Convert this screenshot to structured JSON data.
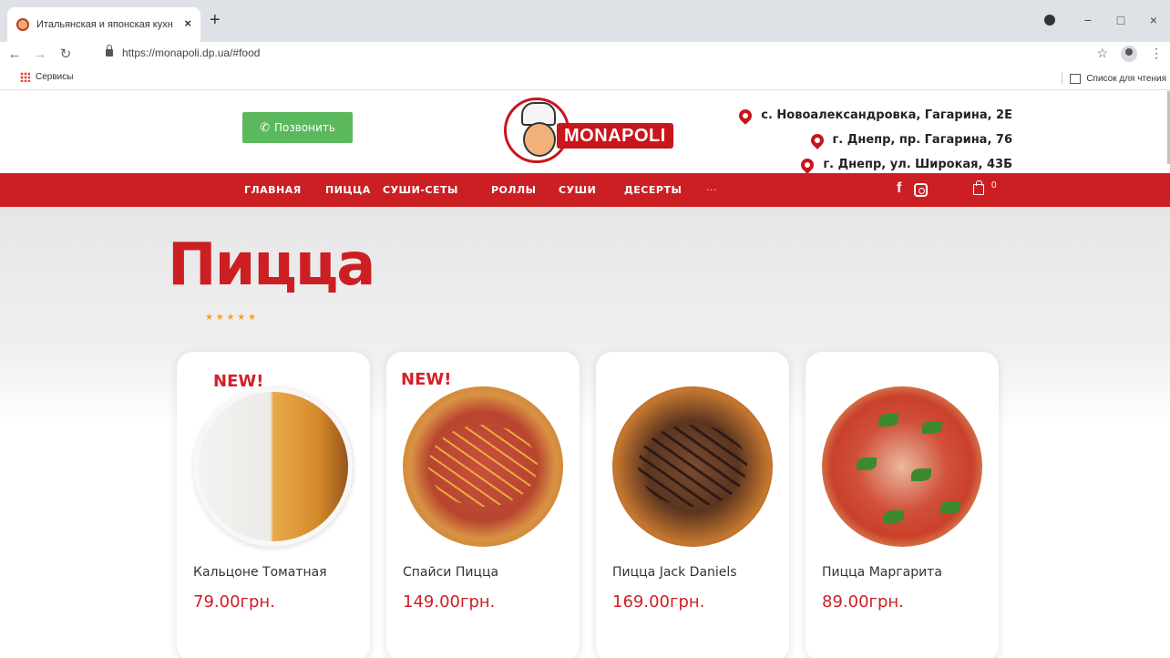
{
  "browser": {
    "tab_title": "Итальянская и японская кухня",
    "tab_close": "×",
    "new_tab": "+",
    "url": "https://monapoli.dp.ua/#food",
    "window_minimize": "−",
    "window_maximize": "□",
    "window_close": "×",
    "bookmarks": {
      "apps_label": "Сервисы",
      "reading_list_label": "Список для чтения"
    }
  },
  "header": {
    "call_button_label": "Позвонить",
    "logo_text": "MONAPOLI",
    "addresses": [
      "с. Новоалександровка, Гагарина, 2Е",
      "г. Днепр, пр. Гагарина, 76",
      "г. Днепр, ул. Широкая, 43Б"
    ]
  },
  "nav": {
    "items": [
      "ГЛАВНАЯ",
      "ПИЦЦА",
      "СУШИ-СЕТЫ",
      "РОЛЛЫ",
      "СУШИ",
      "ДЕСЕРТЫ",
      "···"
    ],
    "cart_count": "0",
    "social_facebook": "f"
  },
  "section": {
    "title": "Пицца",
    "rating_stars": "★ ★ ★ ★ ★"
  },
  "products": [
    {
      "name": "Кальцоне Томатная",
      "price": "79.00грн.",
      "badge": "NEW!"
    },
    {
      "name": "Спайси Пицца",
      "price": "149.00грн.",
      "badge": "NEW!"
    },
    {
      "name": "Пицца Jack Daniels",
      "price": "169.00грн.",
      "badge": ""
    },
    {
      "name": "Пицца Маргарита",
      "price": "89.00грн.",
      "badge": ""
    }
  ],
  "colors": {
    "brand_red": "#cc1f24",
    "call_green": "#5cb85c",
    "star_orange": "#f0a030"
  }
}
